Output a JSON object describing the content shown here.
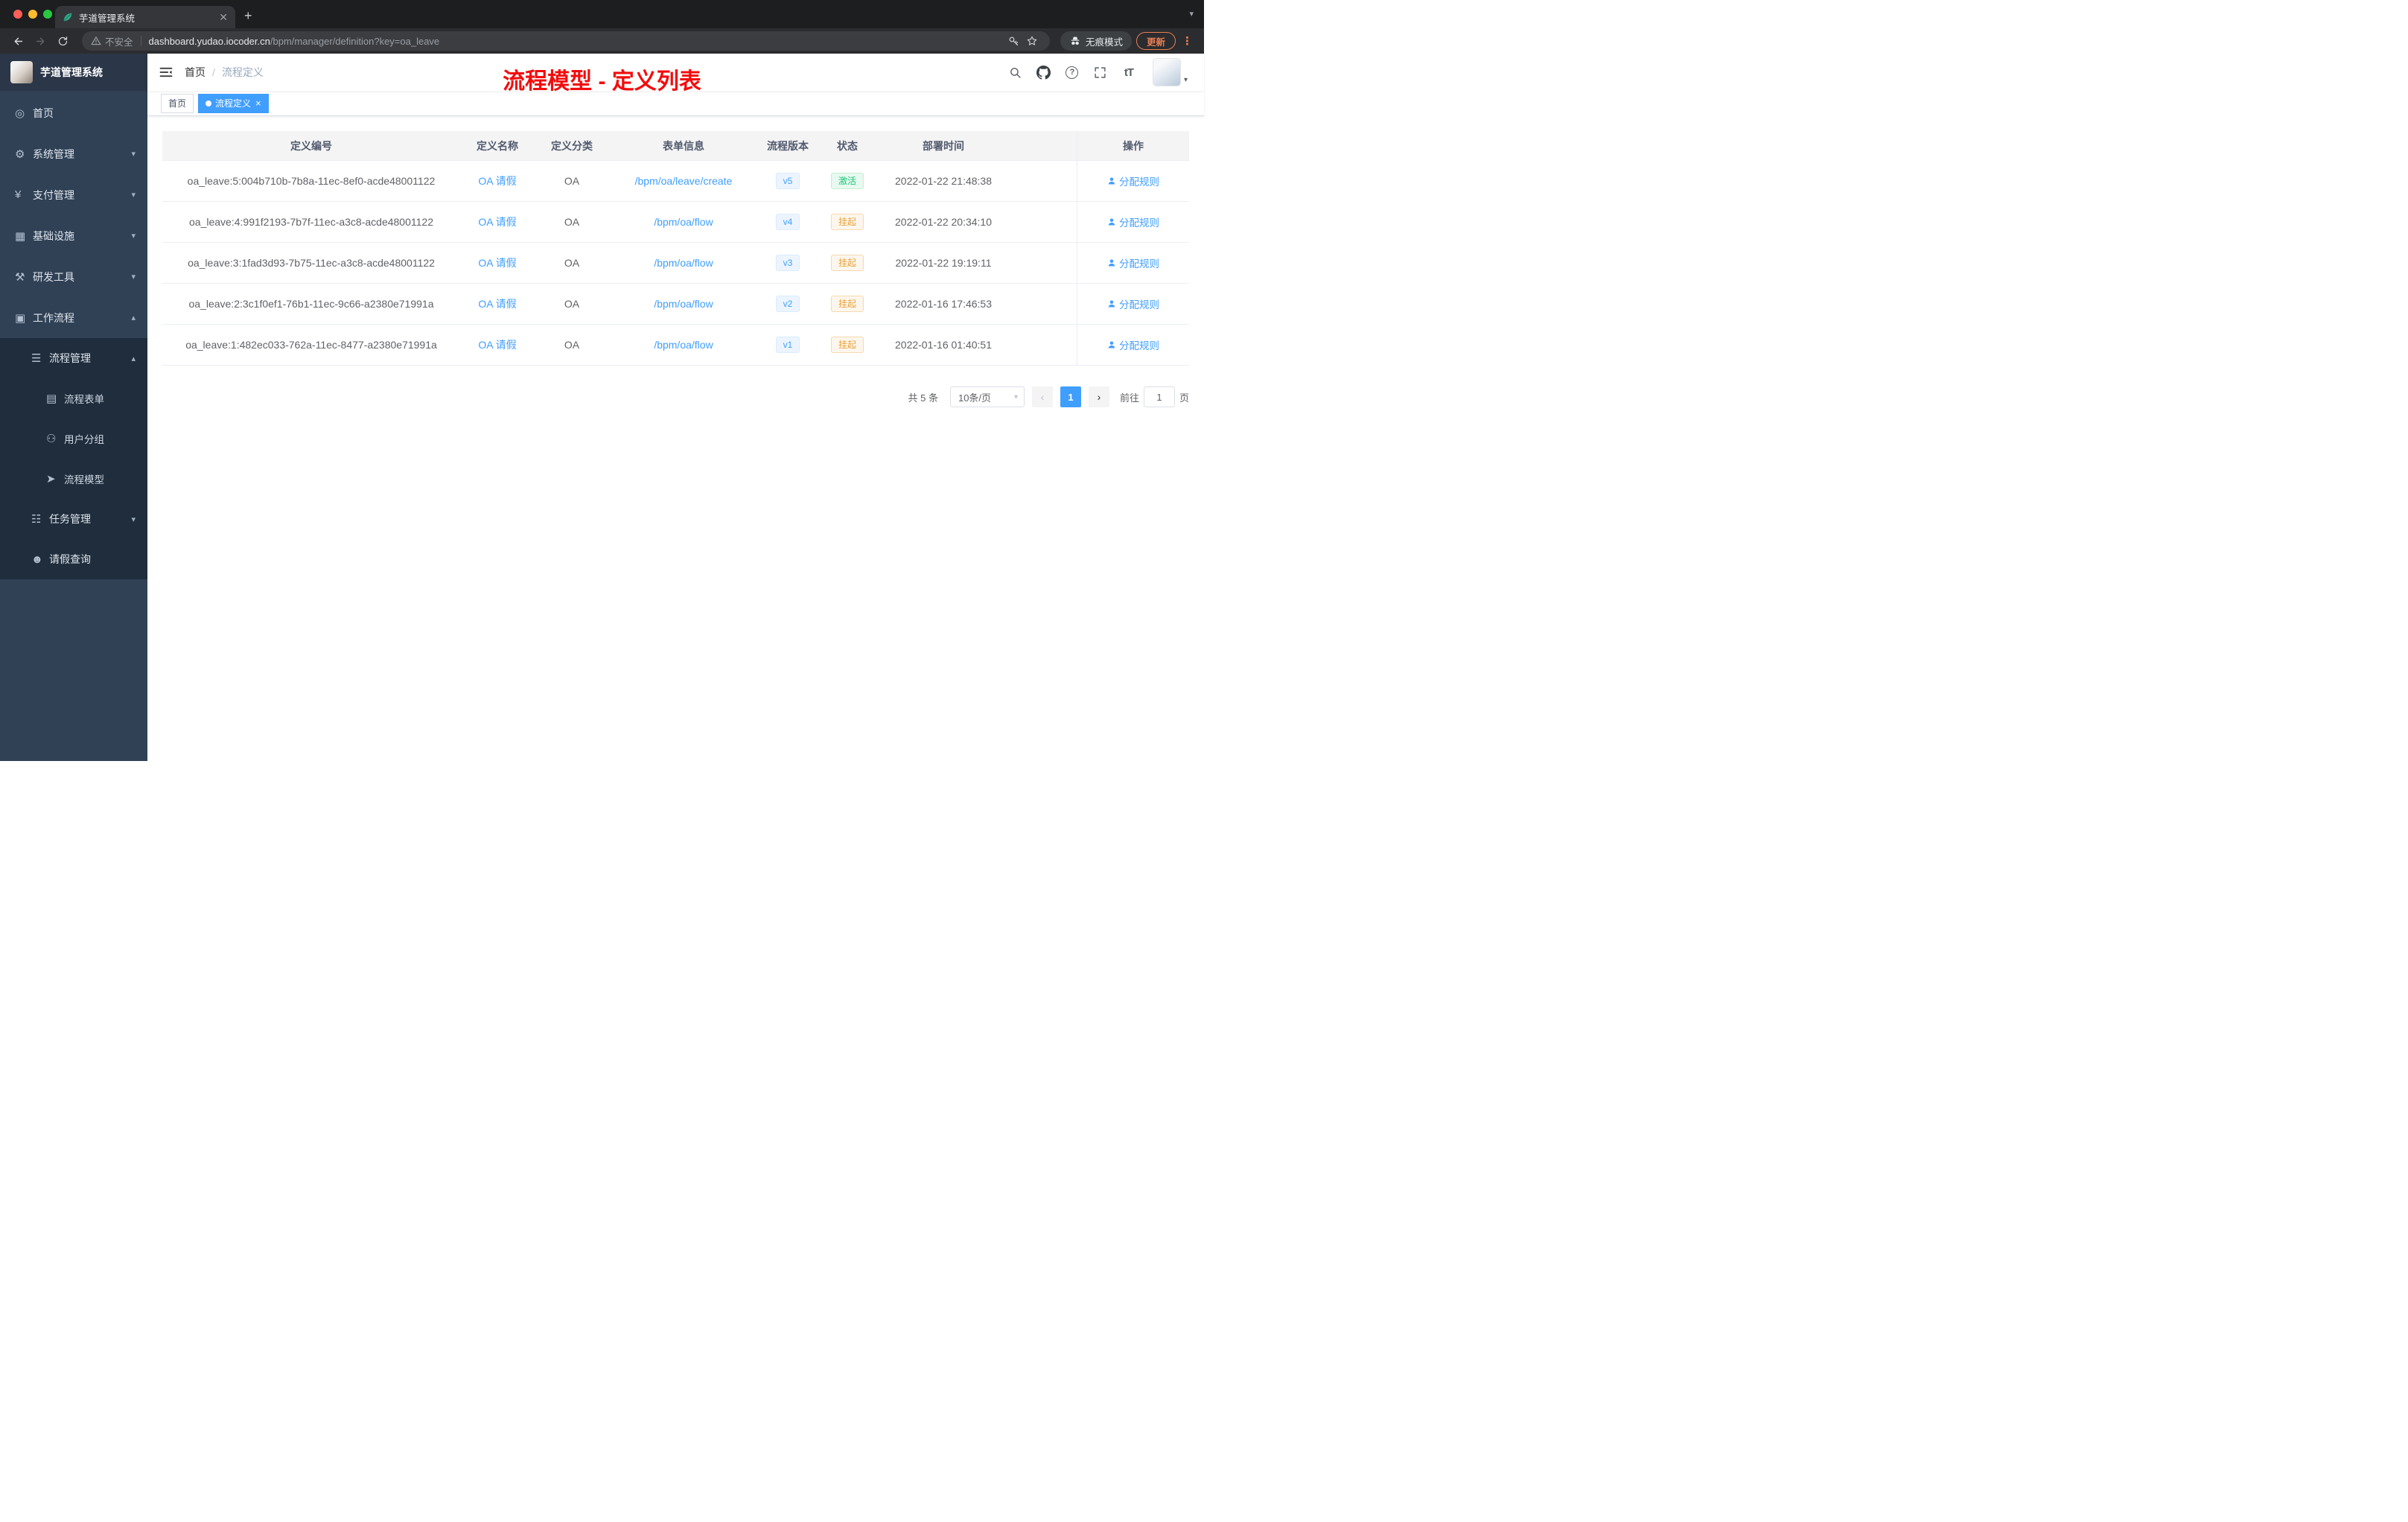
{
  "browser": {
    "tab": {
      "title": "芋道管理系统"
    },
    "toolbar": {
      "security_label": "不安全",
      "url_host": "dashboard.yudao.iocoder.cn",
      "url_path": "/bpm/manager/definition?key=oa_leave",
      "incognito_label": "无痕模式",
      "update_label": "更新",
      "icons": [
        "back-icon",
        "forward-icon",
        "reload-icon",
        "warning-icon",
        "key-icon",
        "star-icon",
        "incognito-icon",
        "more-menu-icon"
      ]
    }
  },
  "sidebar": {
    "brand": "芋道管理系统",
    "menu": [
      {
        "label": "首页",
        "icon": "dashboard-icon",
        "level": 1
      },
      {
        "label": "系统管理",
        "icon": "gear-icon",
        "level": 1,
        "chevron": "down"
      },
      {
        "label": "支付管理",
        "icon": "payment-icon",
        "level": 1,
        "chevron": "down"
      },
      {
        "label": "基础设施",
        "icon": "infrastructure-icon",
        "level": 1,
        "chevron": "down"
      },
      {
        "label": "研发工具",
        "icon": "dev-tools-icon",
        "level": 1,
        "chevron": "down"
      },
      {
        "label": "工作流程",
        "icon": "workflow-icon",
        "level": 1,
        "chevron": "up"
      },
      {
        "label": "流程管理",
        "icon": "process-list-icon",
        "level": 2,
        "sub": true,
        "chevron": "up"
      },
      {
        "label": "流程表单",
        "icon": "form-icon",
        "level": 3,
        "sub": true
      },
      {
        "label": "用户分组",
        "icon": "user-group-icon",
        "level": 3,
        "sub": true
      },
      {
        "label": "流程模型",
        "icon": "process-model-icon",
        "level": 3,
        "sub": true
      },
      {
        "label": "任务管理",
        "icon": "task-icon",
        "level": 2,
        "sub": true,
        "chevron": "down"
      },
      {
        "label": "请假查询",
        "icon": "leave-query-icon",
        "level": 2,
        "sub": true
      }
    ]
  },
  "header": {
    "breadcrumb": [
      "首页",
      "流程定义"
    ],
    "annotation": "流程模型 - 定义列表",
    "font_size_icon_label": "tT",
    "icons": [
      "search-icon",
      "github-icon",
      "question-icon",
      "fullscreen-icon",
      "font-size-icon",
      "avatar"
    ]
  },
  "tags": [
    {
      "label": "首页",
      "active": false,
      "closable": false
    },
    {
      "label": "流程定义",
      "active": true,
      "closable": true
    }
  ],
  "table": {
    "columns": [
      "定义编号",
      "定义名称",
      "定义分类",
      "表单信息",
      "流程版本",
      "状态",
      "部署时间",
      "操作"
    ],
    "action_label": "分配规则",
    "rows": [
      {
        "id": "oa_leave:5:004b710b-7b8a-11ec-8ef0-acde48001122",
        "name": "OA 请假",
        "category": "OA",
        "form": "/bpm/oa/leave/create",
        "version": "v5",
        "status": "激活",
        "status_type": "success",
        "time": "2022-01-22 21:48:38"
      },
      {
        "id": "oa_leave:4:991f2193-7b7f-11ec-a3c8-acde48001122",
        "name": "OA 请假",
        "category": "OA",
        "form": "/bpm/oa/flow",
        "version": "v4",
        "status": "挂起",
        "status_type": "warning",
        "time": "2022-01-22 20:34:10"
      },
      {
        "id": "oa_leave:3:1fad3d93-7b75-11ec-a3c8-acde48001122",
        "name": "OA 请假",
        "category": "OA",
        "form": "/bpm/oa/flow",
        "version": "v3",
        "status": "挂起",
        "status_type": "warning",
        "time": "2022-01-22 19:19:11"
      },
      {
        "id": "oa_leave:2:3c1f0ef1-76b1-11ec-9c66-a2380e71991a",
        "name": "OA 请假",
        "category": "OA",
        "form": "/bpm/oa/flow",
        "version": "v2",
        "status": "挂起",
        "status_type": "warning",
        "time": "2022-01-16 17:46:53"
      },
      {
        "id": "oa_leave:1:482ec033-762a-11ec-8477-a2380e71991a",
        "name": "OA 请假",
        "category": "OA",
        "form": "/bpm/oa/flow",
        "version": "v1",
        "status": "挂起",
        "status_type": "warning",
        "time": "2022-01-16 01:40:51"
      }
    ]
  },
  "pagination": {
    "total": "共 5 条",
    "page_size": "10条/页",
    "current_page": "1",
    "goto_prefix": "前往",
    "goto_value": "1",
    "goto_suffix": "页"
  },
  "colors": {
    "accent_blue": "#409eff",
    "success_green": "#1dc779",
    "warning_orange": "#e6a23c",
    "annotation_red": "#f20d0d",
    "sidebar_bg": "#304156",
    "sidebar_sub_bg": "#1f2d3d",
    "update_orange": "#e87f52"
  }
}
